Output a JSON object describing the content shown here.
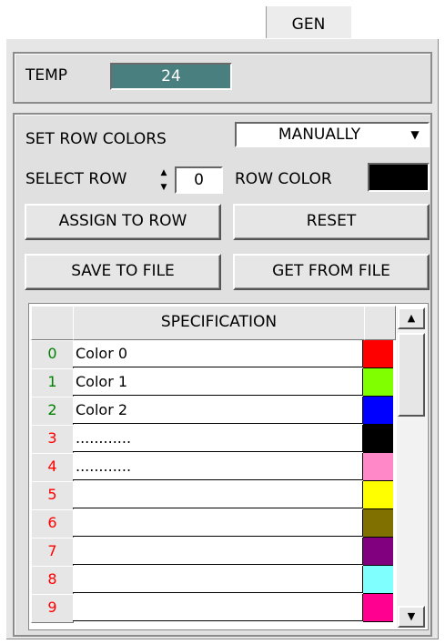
{
  "tab": {
    "label": "GEN"
  },
  "temp": {
    "label": "TEMP",
    "value": "24"
  },
  "row_colors": {
    "label": "SET ROW COLORS",
    "mode": "MANUALLY",
    "select_row_label": "SELECT ROW",
    "select_row_value": "0",
    "row_color_label": "ROW COLOR",
    "row_color_value": "#000000"
  },
  "buttons": {
    "assign": "ASSIGN TO ROW",
    "reset": "RESET",
    "save": "SAVE TO FILE",
    "get": "GET FROM FILE"
  },
  "table": {
    "header": "SPECIFICATION",
    "rows": [
      {
        "index": "0",
        "spec": "Color 0",
        "color": "#ff0000",
        "index_color": "#008000"
      },
      {
        "index": "1",
        "spec": "Color 1",
        "color": "#80ff00",
        "index_color": "#008000"
      },
      {
        "index": "2",
        "spec": "Color 2",
        "color": "#0000ff",
        "index_color": "#008000"
      },
      {
        "index": "3",
        "spec": "............",
        "color": "#000000",
        "index_color": "#ff0000"
      },
      {
        "index": "4",
        "spec": "............",
        "color": "#ff88c8",
        "index_color": "#ff0000"
      },
      {
        "index": "5",
        "spec": "",
        "color": "#ffff00",
        "index_color": "#ff0000"
      },
      {
        "index": "6",
        "spec": "",
        "color": "#807000",
        "index_color": "#ff0000"
      },
      {
        "index": "7",
        "spec": "",
        "color": "#800080",
        "index_color": "#ff0000"
      },
      {
        "index": "8",
        "spec": "",
        "color": "#80ffff",
        "index_color": "#ff0000"
      },
      {
        "index": "9",
        "spec": "",
        "color": "#ff0090",
        "index_color": "#ff0000"
      }
    ]
  },
  "icons": {
    "dropdown_arrow": "triangle-down-icon",
    "spinner": "up-down-spinner-icon",
    "scroll_up": "triangle-up-icon",
    "scroll_down": "triangle-down-icon"
  }
}
